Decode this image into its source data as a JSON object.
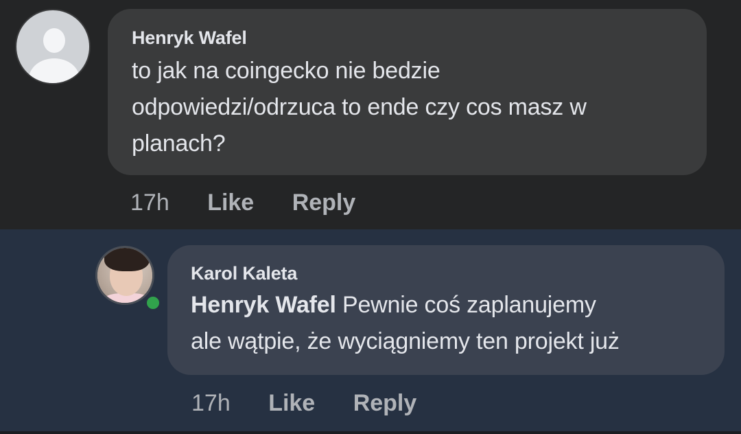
{
  "comment": {
    "author": "Henryk Wafel",
    "lines": [
      "to jak na coingecko nie bedzie",
      "odpowiedzi/odrzuca to ende czy cos masz w",
      "planach?"
    ],
    "time": "17h",
    "like_label": "Like",
    "reply_label": "Reply"
  },
  "reply": {
    "author": "Karol Kaleta",
    "mention": "Henryk Wafel",
    "line1_rest": " Pewnie coś zaplanujemy",
    "line2": "ale wątpie, że wyciągniemy ten projekt już",
    "time": "17h",
    "like_label": "Like",
    "reply_label": "Reply",
    "online_color": "#31a24c"
  }
}
